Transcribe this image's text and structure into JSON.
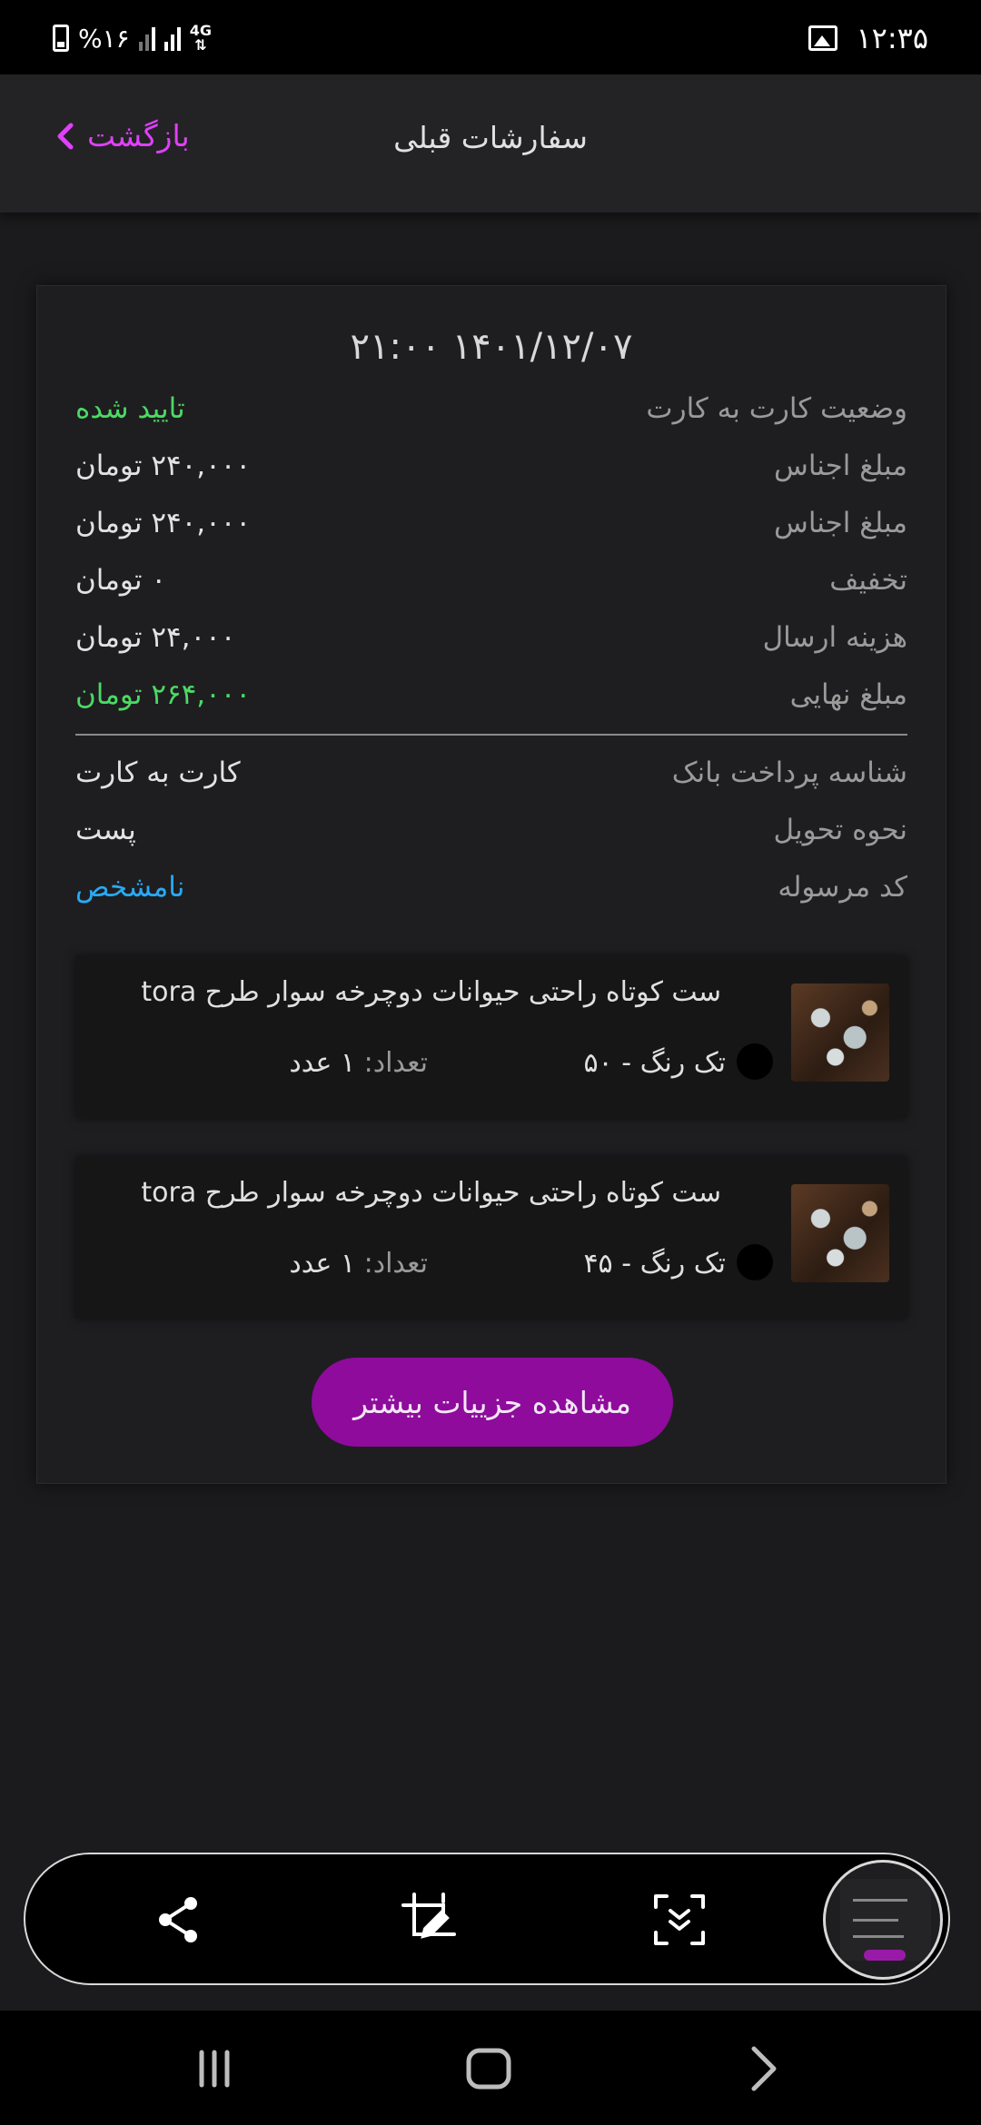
{
  "status_bar": {
    "battery_text": "%۱۶",
    "network": "4G",
    "time": "۱۲:۳۵"
  },
  "header": {
    "title": "سفارشات قبلی",
    "back_label": "بازگشت",
    "accent_color": "#e040fb"
  },
  "order": {
    "date": "۱۴۰۱/۱۲/۰۷ ۲۱:۰۰",
    "rows": [
      {
        "label": "وضعیت کارت به کارت",
        "value": "تایید شده"
      },
      {
        "label": "مبلغ اجناس",
        "value": "۲۴۰,۰۰۰ تومان"
      },
      {
        "label": "مبلغ اجناس",
        "value": "۲۴۰,۰۰۰ تومان"
      },
      {
        "label": "تخفیف",
        "value": "۰ تومان"
      },
      {
        "label": "هزینه ارسال",
        "value": "۲۴,۰۰۰ تومان"
      },
      {
        "label": "مبلغ نهایی",
        "value": "۲۶۴,۰۰۰ تومان"
      }
    ],
    "details": [
      {
        "label": "شناسه پرداخت بانک",
        "value": "کارت به کارت"
      },
      {
        "label": "نحوه تحویل",
        "value": "پست"
      },
      {
        "label": "کد مرسوله",
        "value": "نامشخص"
      }
    ],
    "items": [
      {
        "title": "ست کوتاه راحتی حیوانات دوچرخه سوار طرح tora",
        "variant": "تک رنگ  - ۵۰",
        "qty_label": "تعداد:",
        "qty_value": "۱ عدد",
        "swatch_color": "#000000"
      },
      {
        "title": "ست کوتاه راحتی حیوانات دوچرخه سوار طرح tora",
        "variant": "تک رنگ  - ۴۵",
        "qty_label": "تعداد:",
        "qty_value": "۱ عدد",
        "swatch_color": "#000000"
      }
    ],
    "more_button": "مشاهده جزییات بیشتر",
    "colors": {
      "success": "#4cd964",
      "link": "#29a9f5",
      "button": "#8e0b9c"
    }
  },
  "screenshot_toolbar": {
    "icons": [
      "share-icon",
      "crop-edit-icon",
      "scroll-capture-icon"
    ]
  },
  "nav_bar": {
    "icons": [
      "recents-icon",
      "home-icon",
      "back-chevron-icon"
    ]
  }
}
